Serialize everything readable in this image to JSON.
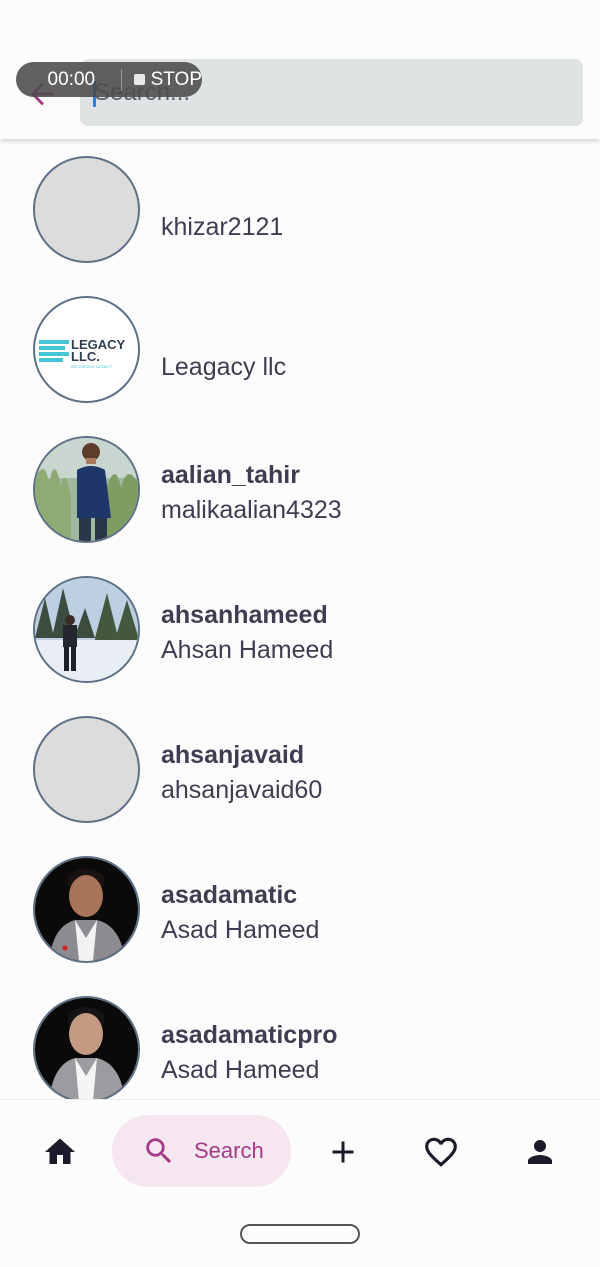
{
  "recording": {
    "time": "00:00",
    "stop_label": "STOP"
  },
  "search": {
    "placeholder": "Search..."
  },
  "users": [
    {
      "username": "",
      "display_name": "khizar2121"
    },
    {
      "username": "",
      "display_name": "Leagacy llc",
      "logo_text": "LEGACY LLC.",
      "logo_tagline": "WE CREATE LEGACY"
    },
    {
      "username": "aalian_tahir",
      "display_name": "malikaalian4323"
    },
    {
      "username": "ahsanhameed",
      "display_name": "Ahsan Hameed"
    },
    {
      "username": "ahsanjavaid",
      "display_name": "ahsanjavaid60"
    },
    {
      "username": "asadamatic",
      "display_name": "Asad Hameed"
    },
    {
      "username": "asadamaticpro",
      "display_name": "Asad Hameed"
    }
  ],
  "bottom_nav": {
    "search_label": "Search"
  },
  "colors": {
    "accent": "#a63a8a",
    "search_pill_bg": "#f5e6ef",
    "search_field_bg": "#dfe3e4",
    "avatar_border": "#5d7187"
  }
}
